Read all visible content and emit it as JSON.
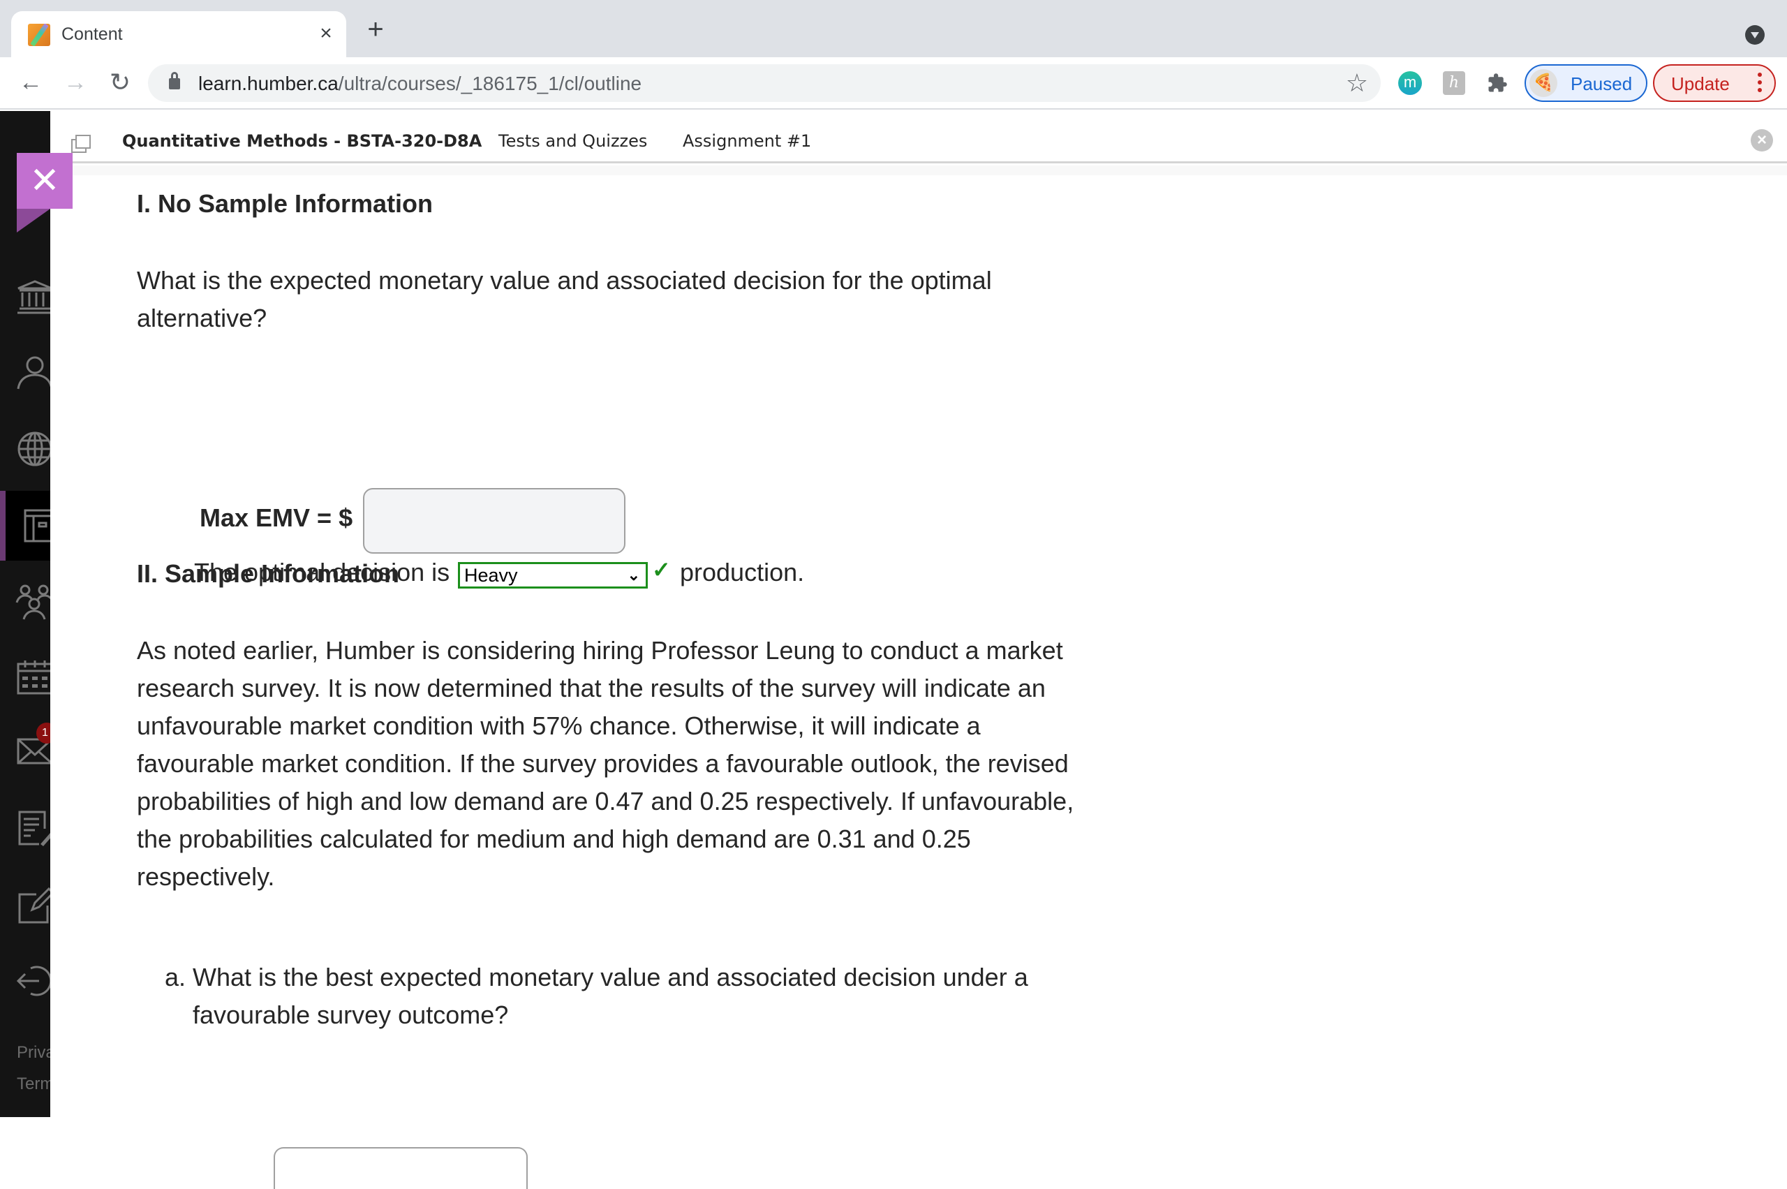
{
  "browser": {
    "tab": {
      "title": "Content",
      "close_glyph": "×",
      "favicon": "pencil-favicon"
    },
    "new_tab_glyph": "+",
    "nav": {
      "back_glyph": "←",
      "forward_glyph": "→",
      "reload_glyph": "↻"
    },
    "url": {
      "host": "learn.humber.ca",
      "path": "/ultra/courses/_186175_1/cl/outline"
    },
    "bookmark_glyph": "☆",
    "extensions": [
      {
        "name": "m-extension",
        "glyph": "m"
      },
      {
        "name": "h-extension",
        "glyph": "h"
      },
      {
        "name": "extensions-puzzle"
      }
    ],
    "profile": {
      "label": "Paused",
      "avatar_glyph": "🍕"
    },
    "update": {
      "label": "Update"
    },
    "colors": {
      "profile_blue": "#1a67d2",
      "update_red": "#c5221f"
    }
  },
  "sidebar": {
    "items": [
      {
        "name": "institution",
        "icon": "bank-icon"
      },
      {
        "name": "profile",
        "icon": "person-icon"
      },
      {
        "name": "activity",
        "icon": "globe-icon"
      },
      {
        "name": "courses",
        "icon": "course-icon",
        "active": true
      },
      {
        "name": "organizations",
        "icon": "groups-icon"
      },
      {
        "name": "calendar",
        "icon": "calendar-icon"
      },
      {
        "name": "messages",
        "icon": "mail-icon",
        "badge": "1"
      },
      {
        "name": "grades",
        "icon": "grades-icon"
      },
      {
        "name": "tools",
        "icon": "edit-icon"
      },
      {
        "name": "sign-out",
        "icon": "logout-icon"
      }
    ],
    "footer": [
      "Privacy",
      "Terms"
    ],
    "accent": "#6b3a73"
  },
  "course_bar": {
    "course": "Quantitative Methods - BSTA-320-D8A",
    "crumbs": [
      "Tests and Quizzes",
      "Assignment #1"
    ],
    "close_glyph": "×"
  },
  "panel": {
    "close_glyph": "✕",
    "accent": "#c270d0"
  },
  "content": {
    "section1_title": "I. No Sample Information",
    "section1_question": "What is the expected monetary value and associated decision for the optimal alternative?",
    "emv_label": "Max EMV = $",
    "emv_value": "",
    "decision_prefix": "The optimal decision is",
    "decision_selected": "Heavy",
    "decision_suffix": "production.",
    "decision_status": "correct",
    "check_glyph": "✓",
    "section2_title": "II. Sample Information",
    "section2_paragraph": "As noted earlier, Humber is considering hiring Professor Leung to conduct a market research survey. It is now determined that the results of the survey will indicate an unfavourable market condition with 57% chance. Otherwise, it will indicate a favourable market condition. If the survey provides a favourable outlook, the revised probabilities of high and low demand are 0.47 and 0.25 respectively. If unfavourable, the probabilities calculated for medium and high demand are 0.31 and 0.25 respectively.",
    "question_a_marker": "a.",
    "question_a": "What is the best expected monetary value and associated decision under a favourable survey outcome?"
  }
}
